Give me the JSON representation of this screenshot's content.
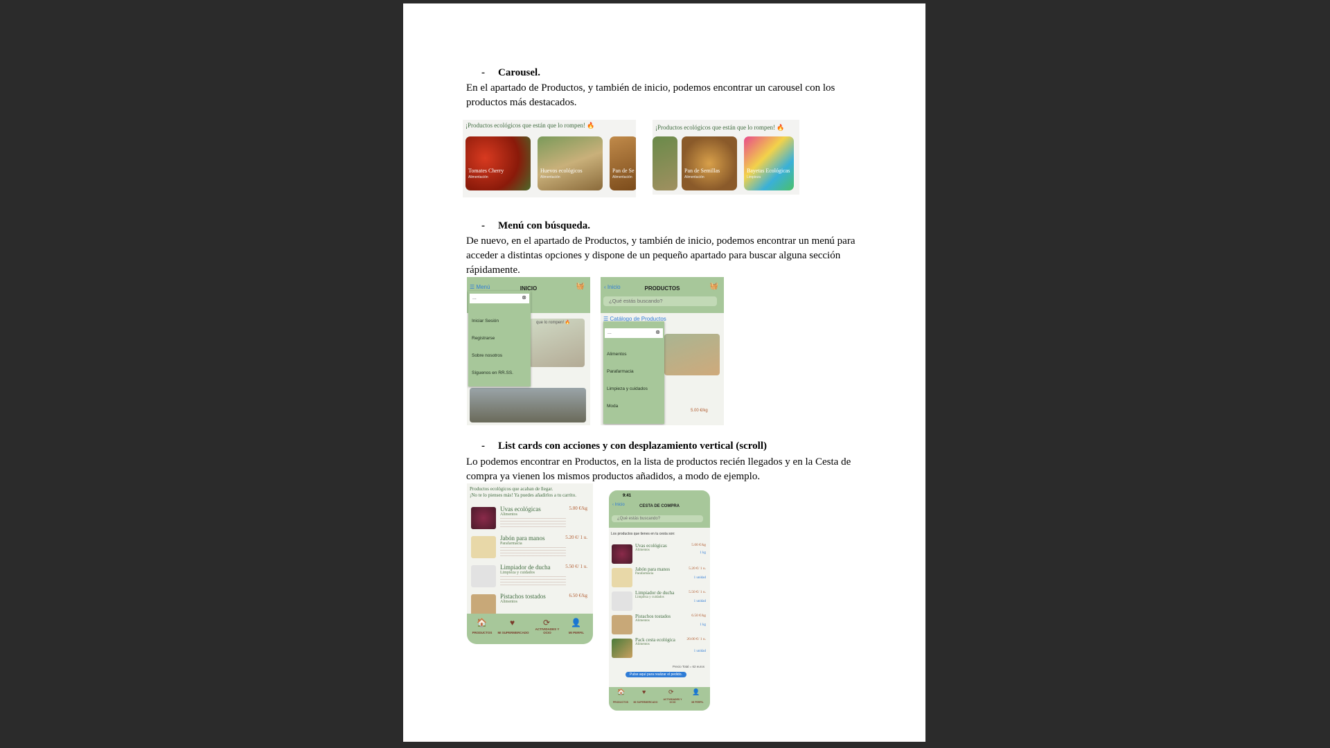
{
  "sections": [
    {
      "dash": "-",
      "heading": "Carousel.",
      "text": "En el apartado de Productos, y también de inicio, podemos encontrar un carousel con los productos más destacados."
    },
    {
      "dash": "-",
      "heading": "Menú con búsqueda.",
      "text": "De nuevo, en el apartado de Productos, y también de inicio, podemos encontrar un menú para acceder a distintas opciones y dispone de un pequeño apartado para buscar alguna sección rápidamente."
    },
    {
      "dash": "-",
      "heading": "List cards con acciones y con desplazamiento vertical (scroll)",
      "text": "Lo podemos encontrar en Productos, en la lista de productos recién llegados y en la Cesta de compra ya vienen los mismos productos añadidos, a modo de ejemplo."
    }
  ],
  "carousel1": {
    "title": "¡Productos ecológicos que están que lo rompen! 🔥",
    "cards": [
      {
        "label": "Tomates Cherry",
        "sub": "Alimentación"
      },
      {
        "label": "Huevos ecológicos",
        "sub": "Alimentación"
      },
      {
        "label": "Pan de Se",
        "sub": "Alimentación"
      }
    ]
  },
  "carousel2": {
    "title": "¡Productos ecológicos que están que lo rompen! 🔥",
    "cards": [
      {
        "label": "",
        "sub": ""
      },
      {
        "label": "Pan de Semillas",
        "sub": "Alimentación"
      },
      {
        "label": "Bayetas Ecológicas",
        "sub": "Limpieza"
      }
    ]
  },
  "menu1": {
    "menu_label": "Menú",
    "title": "INICIO",
    "search_value": "...",
    "items": [
      "Iniciar Sesión",
      "Registrarse",
      "Sobre nosotros",
      "Síguenos en RR.SS."
    ],
    "bg_text": "que lo rompen! 🔥"
  },
  "menu2": {
    "back_label": "Inicio",
    "title": "PRODUCTOS",
    "search_placeholder": "¿Qué estás buscando?",
    "catalog_label": "Catálogo de Productos",
    "search_value": "...",
    "items": [
      "Alimentos",
      "Parafarmacia",
      "Limpieza y cuidados",
      "Moda"
    ],
    "price": "5.00 €/kg"
  },
  "list1": {
    "intro1": "Productos ecológicos que acaban de llegar.",
    "intro2": "¡No te lo pienses más! Ya puedes añadirlos a tu carrito.",
    "rows": [
      {
        "name": "Uvas ecológicas",
        "cat": "Alimentos",
        "price": "5.00 €/kg"
      },
      {
        "name": "Jabón para manos",
        "cat": "Parafarmacia",
        "price": "5.20 €/ 1 u."
      },
      {
        "name": "Limpiador de ducha",
        "cat": "Limpieza y cuidados",
        "price": "5.50 €/ 1 u."
      },
      {
        "name": "Pistachos tostados",
        "cat": "Alimentos",
        "price": "6.50 €/kg"
      }
    ],
    "tabs": [
      "PRODUCTOS",
      "MI SUPERMERCADO",
      "ACTIVIDADES Y OCIO",
      "MI PERFIL"
    ]
  },
  "list2": {
    "time": "9:41",
    "back_label": "Inicio",
    "title": "CESTA DE COMPRA",
    "search_placeholder": "¿Qué estás buscando?",
    "intro": "Los productos que tienes en tu cesta son:",
    "rows": [
      {
        "name": "Uvas ecológicas",
        "cat": "Alimentos",
        "price": "5.00 €/kg",
        "qty": "1 kg"
      },
      {
        "name": "Jabón para manos",
        "cat": "Parafarmacia",
        "price": "5.20 €/ 1 u.",
        "qty": "1 unidad"
      },
      {
        "name": "Limpiador de ducha",
        "cat": "Limpieza y cuidados",
        "price": "5.50 €/ 1 u.",
        "qty": "1 unidad"
      },
      {
        "name": "Pistachos tostados",
        "cat": "Alimentos",
        "price": "6.50 €/kg",
        "qty": "1 kg"
      },
      {
        "name": "Pack cesta ecológica",
        "cat": "Alimentos",
        "price": "20.00 €/ 1 u.",
        "qty": "1 unidad"
      }
    ],
    "total": "Precio Total = 62 euros",
    "cta": "Pulse aquí para realizar el pedido.",
    "tabs": [
      "PRODUCTOS",
      "MI SUPERMERCADO",
      "ACTIVIDADES Y OCIO",
      "MI PERFIL"
    ]
  },
  "colors": {
    "green": "#a7c79a",
    "accent": "#2f7cd6",
    "brown": "#7a3a2a"
  }
}
